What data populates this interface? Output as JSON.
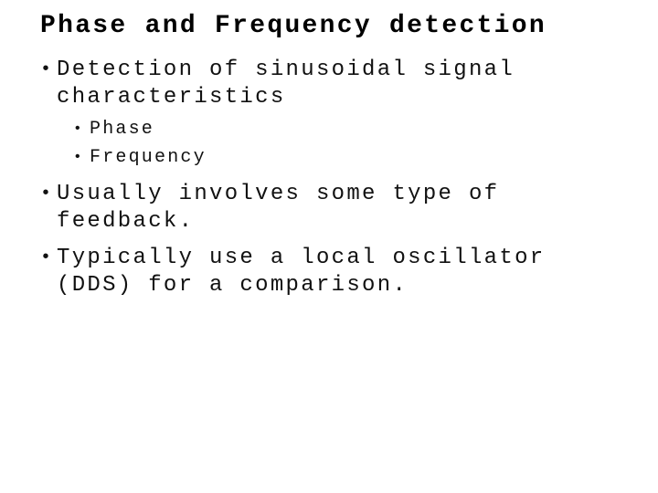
{
  "slide": {
    "title": "Phase and Frequency detection",
    "bullet_glyph": "•",
    "bullets": [
      {
        "lines": [
          "Detection of sinusoidal signal",
          "characteristics"
        ],
        "subbullets": [
          "Phase",
          "Frequency"
        ]
      },
      {
        "lines": [
          "Usually involves some type of",
          "feedback."
        ]
      },
      {
        "lines": [
          "Typically use a local oscillator",
          "(DDS) for a comparison."
        ]
      }
    ]
  }
}
